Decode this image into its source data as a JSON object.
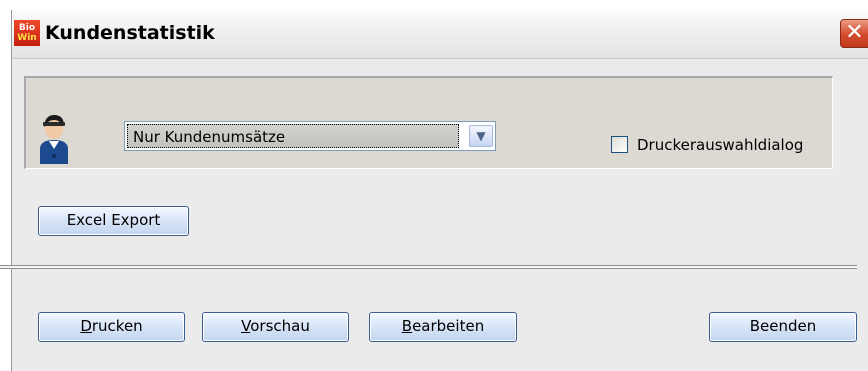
{
  "window": {
    "title": "Kundenstatistik",
    "app_logo_top": "Bio",
    "app_logo_bottom": "Win",
    "close_glyph": "✕"
  },
  "report": {
    "selected_option": "Nur Kundenumsätze",
    "dropdown_arrow": "▼"
  },
  "options": {
    "printer_dialog_label": "Druckerauswahldialog",
    "printer_dialog_checked": false
  },
  "buttons": {
    "excel_export": "Excel Export",
    "print_first": "D",
    "print_rest": "rucken",
    "preview_first": "V",
    "preview_rest": "orschau",
    "edit_first": "B",
    "edit_rest": "earbeiten",
    "quit": "Beenden"
  },
  "icons": {
    "user": "user-icon",
    "app": "biowin-logo-icon",
    "close": "close-icon"
  },
  "colors": {
    "panel": "#dcd9d2",
    "button_border": "#3b5e91",
    "close_button": "#d24a2c"
  }
}
